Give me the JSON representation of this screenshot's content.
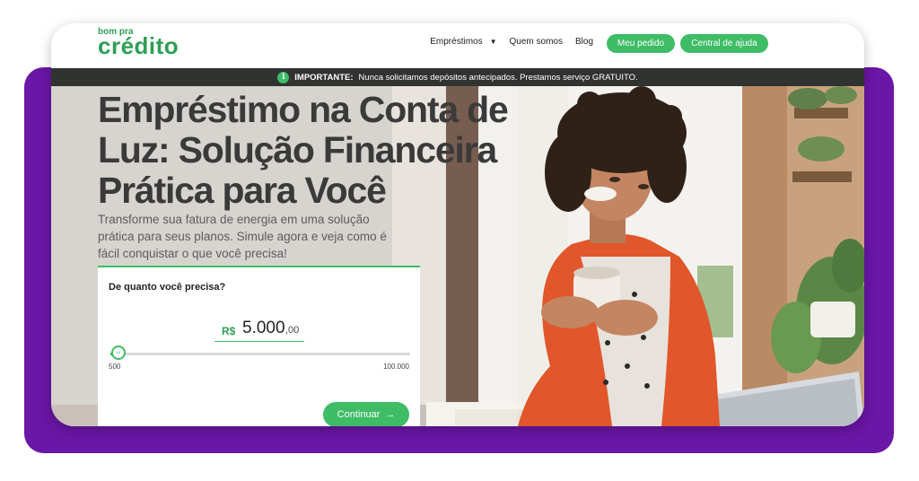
{
  "logo": {
    "small": "bom pra",
    "big": "crédito"
  },
  "nav": {
    "emprestimos": "Empréstimos",
    "quem_somos": "Quem somos",
    "blog": "Blog",
    "meu_pedido": "Meu pedido",
    "central_ajuda": "Central de ajuda"
  },
  "banner": {
    "strong": "IMPORTANTE:",
    "text": "Nunca solicitamos depósitos antecipados. Prestamos serviço GRATUITO."
  },
  "hero": {
    "headline": "Empréstimo na Conta de Luz: Solução Financeira Prática para Você",
    "subtext": "Transforme sua fatura de energia em uma solução prática para seus planos. Simule agora e veja como é fácil conquistar o que você precisa!"
  },
  "form": {
    "title": "De quanto você precisa?",
    "currency": "R$",
    "amount_int": "5.000",
    "amount_dec": ",00",
    "slider_min": "500",
    "slider_max": "100.000",
    "slider_fraction": 0.045,
    "continue_label": "Continuar",
    "continue_arrow": "→"
  },
  "icons": {
    "info": "info-icon",
    "caret": "chevron-down-icon",
    "arrow": "arrow-right-icon",
    "slider": "slider-handle-icon"
  },
  "colors": {
    "brand_green": "#3ebc66",
    "banner_bg": "#303330",
    "frame_purple": "#6a16a6"
  }
}
